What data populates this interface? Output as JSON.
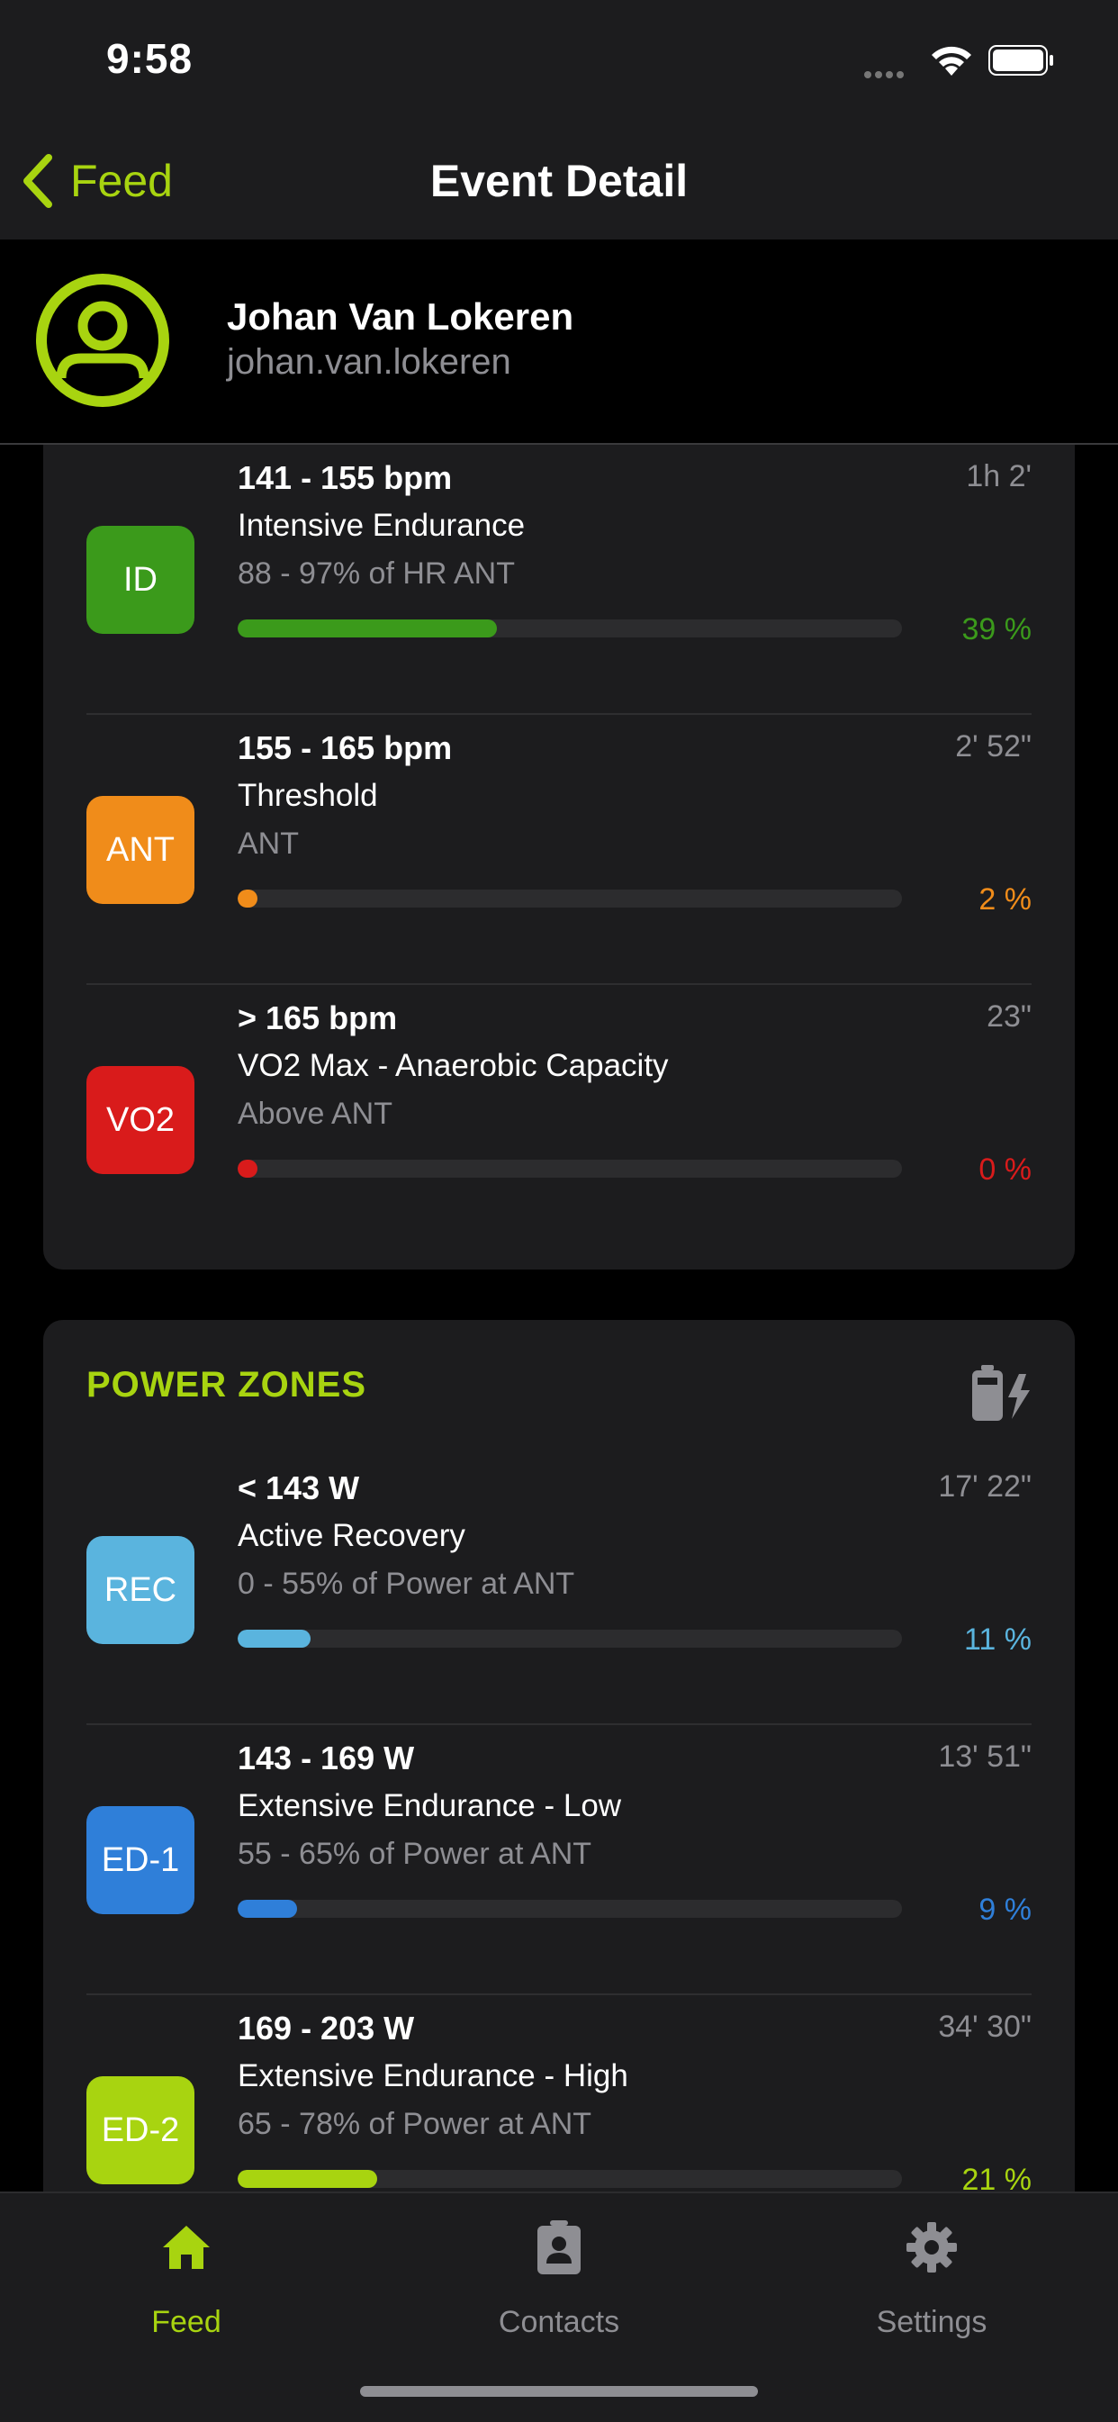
{
  "status_bar": {
    "time": "9:58"
  },
  "nav": {
    "back_label": "Feed",
    "title": "Event Detail"
  },
  "profile": {
    "name": "Johan Van Lokeren",
    "username": "johan.van.lokeren"
  },
  "hr_zones": [
    {
      "badge": "ID",
      "color": "#3b9a1b",
      "range": "141 - 155 bpm",
      "name": "Intensive Endurance",
      "desc": "88 - 97% of HR ANT",
      "time": "1h 2'",
      "percent": "39 %",
      "fill": 0.39
    },
    {
      "badge": "ANT",
      "color": "#f08c1a",
      "range": "155 - 165 bpm",
      "name": "Threshold",
      "desc": "ANT",
      "time": "2' 52\"",
      "percent": "2 %",
      "fill": 0.02
    },
    {
      "badge": "VO2",
      "color": "#d91b1b",
      "range": "> 165 bpm",
      "name": "VO2 Max - Anaerobic Capacity",
      "desc": "Above ANT",
      "time": "23\"",
      "percent": "0 %",
      "fill": 0.0
    }
  ],
  "power_zones": {
    "title": "POWER ZONES",
    "icon": "battery-charging-icon",
    "items": [
      {
        "badge": "REC",
        "color": "#5ab4de",
        "range": "< 143 W",
        "name": "Active Recovery",
        "desc": "0 - 55% of Power at ANT",
        "time": "17' 22\"",
        "percent": "11 %",
        "fill": 0.11
      },
      {
        "badge": "ED-1",
        "color": "#2f7fd9",
        "range": "143 - 169 W",
        "name": "Extensive Endurance - Low",
        "desc": "55 - 65% of Power at ANT",
        "time": "13' 51\"",
        "percent": "9 %",
        "fill": 0.09
      },
      {
        "badge": "ED-2",
        "color": "#a8d410",
        "range": "169 - 203 W",
        "name": "Extensive Endurance - High",
        "desc": "65 - 78% of Power at ANT",
        "time": "34' 30\"",
        "percent": "21 %",
        "fill": 0.21
      }
    ]
  },
  "tabs": [
    {
      "label": "Feed",
      "icon": "home-icon",
      "active": true
    },
    {
      "label": "Contacts",
      "icon": "contact-card-icon",
      "active": false
    },
    {
      "label": "Settings",
      "icon": "gear-icon",
      "active": false
    }
  ],
  "colors": {
    "accent": "#a8d410",
    "background": "#000000",
    "card": "#1c1c1e"
  }
}
